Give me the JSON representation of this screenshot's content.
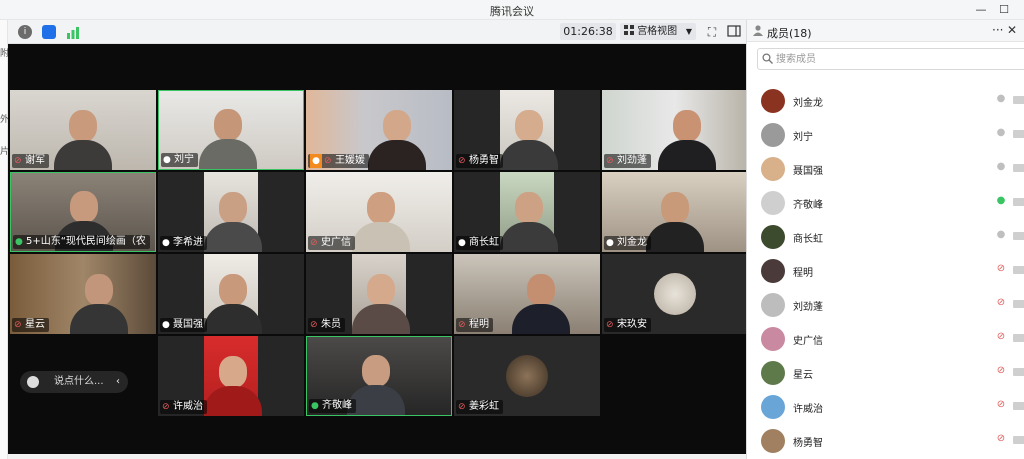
{
  "window": {
    "title": "腾讯会议"
  },
  "left_strip": {
    "chars": [
      "附",
      "外",
      "片"
    ]
  },
  "toolbar": {
    "timer": "01:26:38",
    "view_label": "宫格视图"
  },
  "panel": {
    "title": "成员(18)",
    "search_placeholder": "搜索成员",
    "members": [
      {
        "name": "刘金龙",
        "mic": "on",
        "avatar_color": "#8a3320"
      },
      {
        "name": "刘宁",
        "mic": "on",
        "avatar_color": "#9a9a9a"
      },
      {
        "name": "聂国强",
        "mic": "on",
        "avatar_color": "#d8b08a"
      },
      {
        "name": "齐敬峰",
        "mic": "active",
        "avatar_color": "#cfcfcf"
      },
      {
        "name": "商长虹",
        "mic": "on",
        "avatar_color": "#3c4a2e"
      },
      {
        "name": "程明",
        "mic": "muted",
        "avatar_color": "#4a3a3a"
      },
      {
        "name": "刘劲蓬",
        "mic": "muted",
        "avatar_color": "#bdbdbd"
      },
      {
        "name": "史广信",
        "mic": "muted",
        "avatar_color": "#c98aa1"
      },
      {
        "name": "星云",
        "mic": "muted",
        "avatar_color": "#5e7a4a"
      },
      {
        "name": "许威治",
        "mic": "muted",
        "avatar_color": "#6aa5d8"
      },
      {
        "name": "杨勇智",
        "mic": "muted",
        "avatar_color": "#a08060"
      }
    ]
  },
  "tiles": [
    {
      "name": "谢军",
      "mic": "muted"
    },
    {
      "name": "刘宁",
      "mic": "on"
    },
    {
      "name": "王媛媛",
      "mic": "muted",
      "host": true
    },
    {
      "name": "杨勇智",
      "mic": "muted"
    },
    {
      "name": "刘劲蓬",
      "mic": "muted"
    },
    {
      "name": "5+山东“现代民间绘画（农",
      "mic": "active"
    },
    {
      "name": "李希进",
      "mic": "on"
    },
    {
      "name": "史广信",
      "mic": "muted"
    },
    {
      "name": "商长虹",
      "mic": "on"
    },
    {
      "name": "刘金龙",
      "mic": "on"
    },
    {
      "name": "星云",
      "mic": "muted"
    },
    {
      "name": "聂国强",
      "mic": "on"
    },
    {
      "name": "朱员",
      "mic": "muted"
    },
    {
      "name": "程明",
      "mic": "muted"
    },
    {
      "name": "宋玖安",
      "mic": "muted"
    },
    {
      "name": "许威治",
      "mic": "muted"
    },
    {
      "name": "齐敬峰",
      "mic": "active"
    },
    {
      "name": "姜彩虹",
      "mic": "muted"
    }
  ],
  "speaker_bar": {
    "text": "说点什么..."
  },
  "colors": {
    "stage": "#0b0b0b",
    "mic_active": "#3ac463",
    "mic_muted": "#e25c5c",
    "accent": "#1e6fe8"
  }
}
